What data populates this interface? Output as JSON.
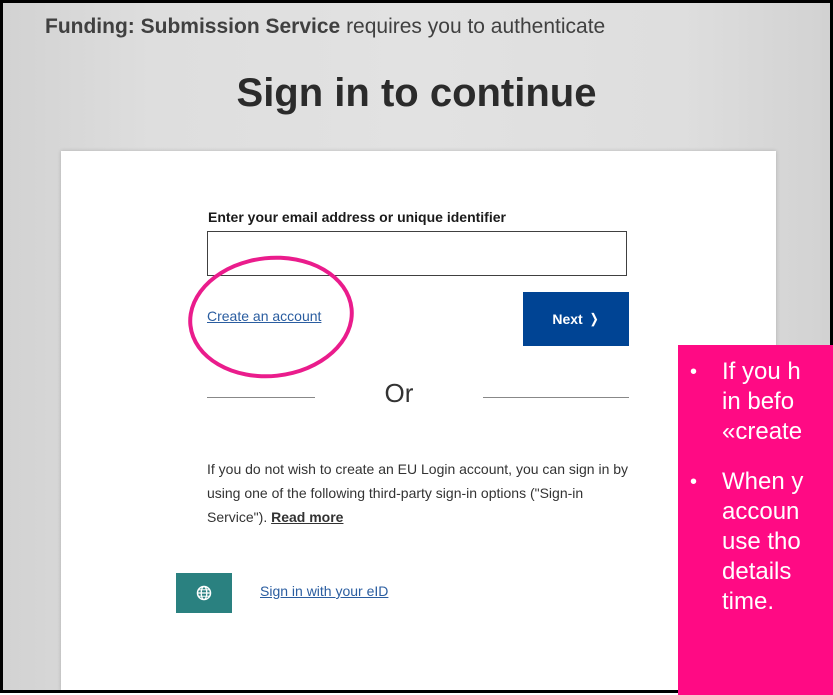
{
  "header": {
    "service_name": "Funding: Submission Service",
    "requirement": "requires you to authenticate"
  },
  "title": "Sign in to continue",
  "form": {
    "email_label": "Enter your email address or unique identifier",
    "email_value": "",
    "email_placeholder": "",
    "create_account_label": "Create an account",
    "next_label": "Next",
    "next_icon": "chevron-right-icon"
  },
  "divider": {
    "or_label": "Or"
  },
  "third_party": {
    "description": "If you do not wish to create an EU Login account, you can sign in by using one of the following third-party sign-in options (\"Sign-in Service\").",
    "read_more_label": "Read more",
    "eid_icon": "globe-icon",
    "eid_label": "Sign in with your eID"
  },
  "callout": {
    "items": [
      "If you h\nin befo\n«create",
      "When y\naccoun\nuse tho\ndetails\ntime."
    ]
  },
  "colors": {
    "primary_button": "#004494",
    "link": "#2a5da0",
    "eid_button": "#2a8180",
    "highlight": "#ea1c8c",
    "callout_bg": "#ff0a84"
  }
}
